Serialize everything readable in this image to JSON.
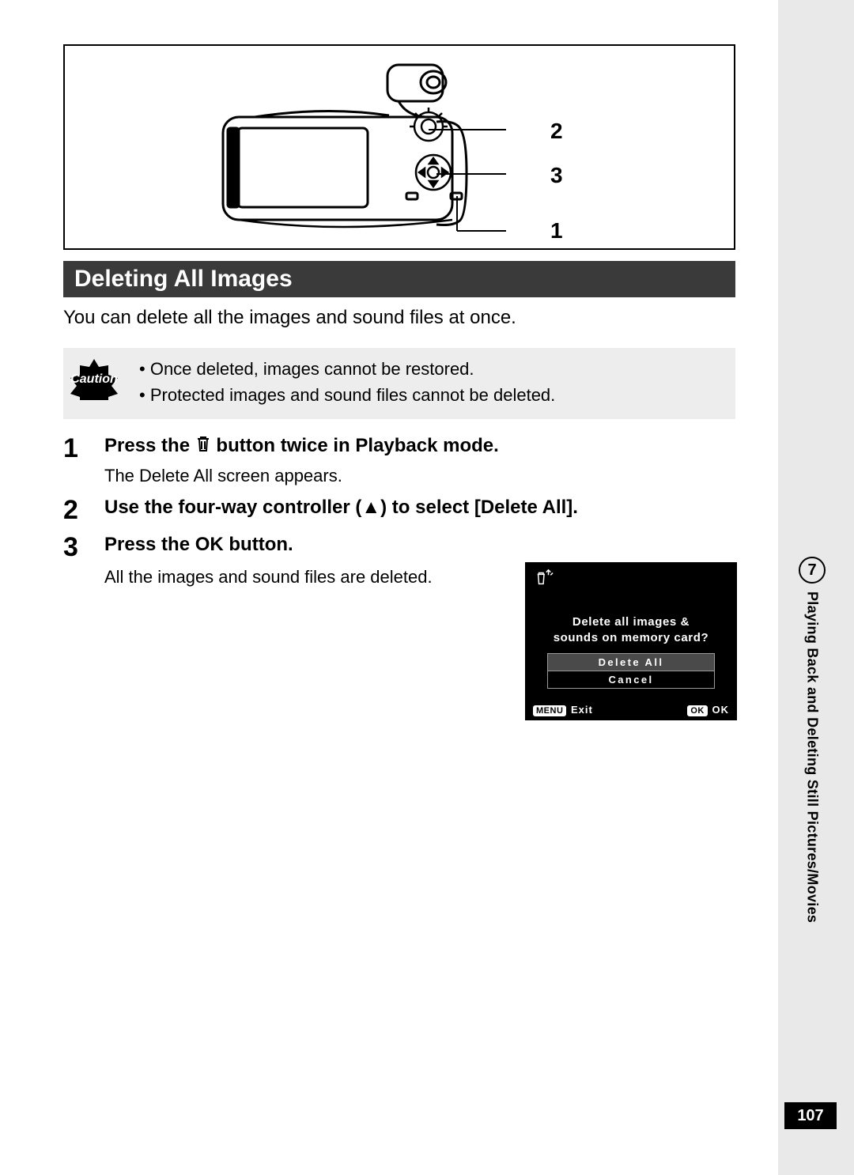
{
  "section_title": "Deleting All Images",
  "intro": "You can delete all the images and sound files at once.",
  "caution": {
    "bullets": [
      "Once deleted, images cannot be restored.",
      "Protected images and sound files cannot be deleted."
    ]
  },
  "callouts": {
    "a": "2",
    "b": "3",
    "c": "1"
  },
  "steps": [
    {
      "num": "1",
      "title_pre": "Press the ",
      "title_post": " button twice in Playback mode.",
      "desc": "The Delete All screen appears."
    },
    {
      "num": "2",
      "title_full": "Use the four-way controller (▲) to select [Delete All]."
    },
    {
      "num": "3",
      "title_full": "Press the OK button.",
      "desc": "All the images and sound files are deleted."
    }
  ],
  "lcd": {
    "msg_l1": "Delete all images &",
    "msg_l2": "sounds on memory card?",
    "opt1": "Delete All",
    "opt2": "Cancel",
    "foot_menu_chip": "MENU",
    "foot_menu_label": "Exit",
    "foot_ok_chip": "OK",
    "foot_ok_label": "OK"
  },
  "sidebar": {
    "chapter_num": "7",
    "chapter_title": "Playing Back and Deleting Still Pictures/Movies"
  },
  "page_number": "107"
}
